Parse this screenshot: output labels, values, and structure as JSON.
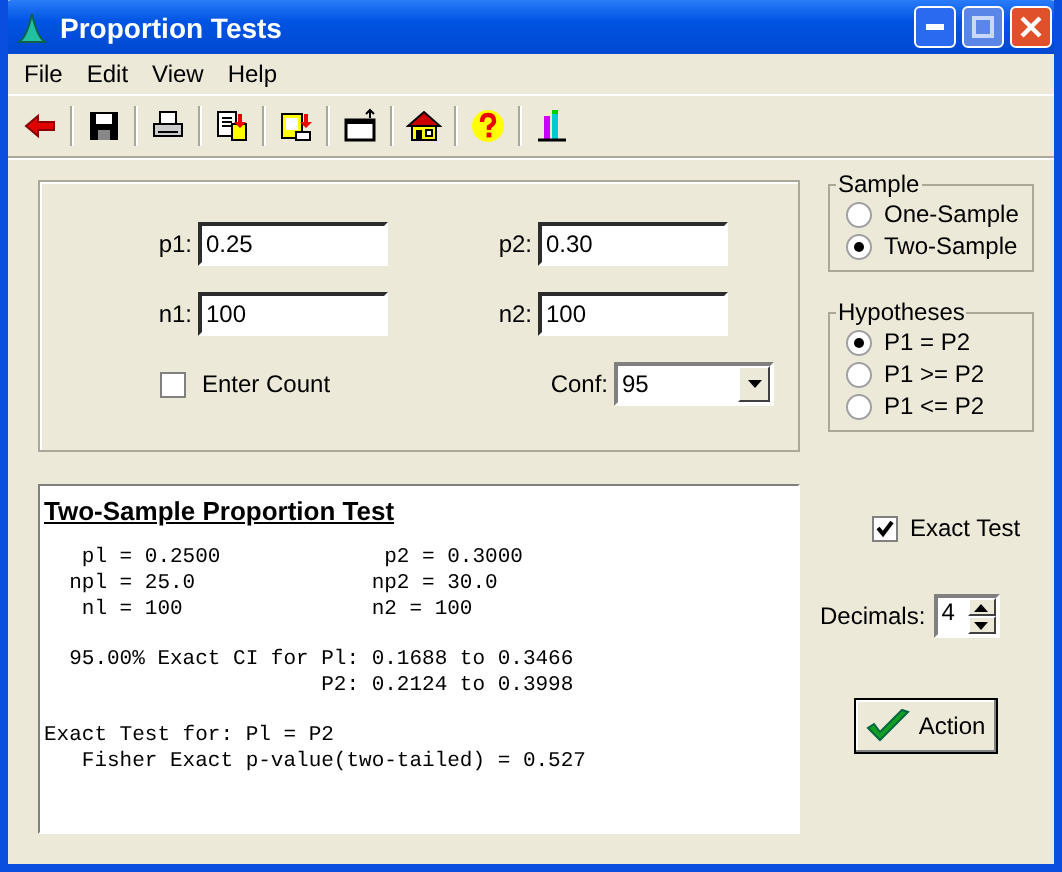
{
  "window": {
    "title": "Proportion Tests"
  },
  "menu": [
    "File",
    "Edit",
    "View",
    "Help"
  ],
  "toolbar": [
    {
      "kind": "back"
    },
    {
      "kind": "save"
    },
    {
      "kind": "print"
    },
    {
      "kind": "copy"
    },
    {
      "kind": "paste"
    },
    {
      "kind": "window"
    },
    {
      "kind": "home"
    },
    {
      "kind": "help"
    },
    {
      "kind": "chart"
    }
  ],
  "inputs": [
    {
      "label": "p1:",
      "value": "0.25"
    },
    {
      "label": "p2:",
      "value": "0.30"
    },
    {
      "label": "n1:",
      "value": "100"
    },
    {
      "label": "n2:",
      "value": "100"
    }
  ],
  "enter_count": {
    "label": "Enter Count",
    "checked": false
  },
  "conf": {
    "label": "Conf:",
    "value": "95"
  },
  "sample": {
    "title": "Sample",
    "options": [
      {
        "label": "One-Sample",
        "selected": false
      },
      {
        "label": "Two-Sample",
        "selected": true
      }
    ]
  },
  "hypotheses": {
    "title": "Hypotheses",
    "options": [
      {
        "label": "P1  =  P2",
        "selected": true
      },
      {
        "label": "P1 >= P2",
        "selected": false
      },
      {
        "label": "P1 <= P2",
        "selected": false
      }
    ]
  },
  "output": {
    "title": "Two-Sample Proportion Test",
    "blocks": [
      [
        "   pl = 0.2500             p2 = 0.3000",
        "  npl = 25.0              np2 = 30.0",
        "   nl = 100               n2 = 100"
      ],
      [
        "  95.00% Exact CI for Pl: 0.1688 to 0.3466",
        "                      P2: 0.2124 to 0.3998"
      ],
      [
        "Exact Test for: Pl = P2",
        "   Fisher Exact p-value(two-tailed) = 0.527"
      ]
    ]
  },
  "exact_test": {
    "label": "Exact Test",
    "checked": true
  },
  "decimals": {
    "label": "Decimals:",
    "value": "4"
  },
  "action": {
    "label": "Action"
  }
}
